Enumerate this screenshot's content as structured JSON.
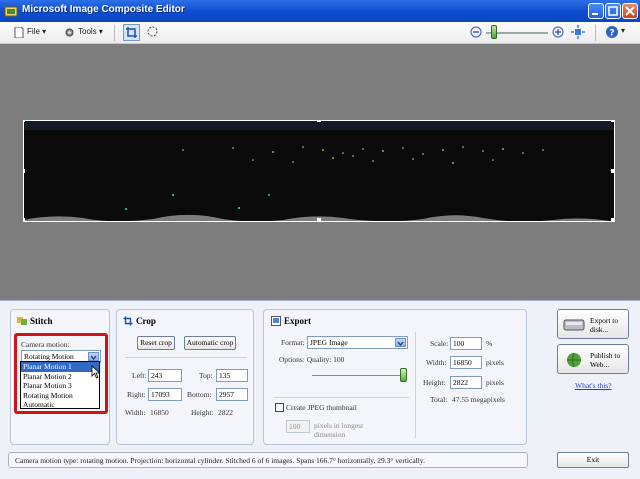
{
  "window": {
    "title": "Microsoft Image Composite Editor"
  },
  "menu": {
    "file": "File",
    "tools": "Tools"
  },
  "stitch": {
    "title": "Stitch",
    "camera_motion_label": "Camera motion:",
    "camera_motion_value": "Rotating Motion",
    "options": [
      "Planar Motion 1",
      "Planar Motion 2",
      "Planar Motion 3",
      "Rotating Motion",
      "Automatic"
    ]
  },
  "crop": {
    "title": "Crop",
    "reset_label": "Reset crop",
    "auto_label": "Automatic crop",
    "left_label": "Left:",
    "left_value": "243",
    "top_label": "Top:",
    "top_value": "135",
    "right_label": "Right:",
    "right_value": "17093",
    "bottom_label": "Bottom:",
    "bottom_value": "2957",
    "width_label": "Width:",
    "width_value": "16850",
    "height_label": "Height:",
    "height_value": "2822"
  },
  "export": {
    "title": "Export",
    "format_label": "Format:",
    "format_value": "JPEG Image",
    "options_label": "Options: Quality: 100",
    "thumbnail_label": "Create JPEG thumbnail",
    "thumb_value": "100",
    "thumb_unit": "pixels in longest dimension",
    "scale_label": "Scale:",
    "scale_value": "100",
    "scale_unit": "%",
    "width_label": "Width:",
    "width_value": "16850",
    "width_unit": "pixels",
    "height_label": "Height:",
    "height_value": "2822",
    "height_unit": "pixels",
    "total_label": "Total:",
    "total_value": "47.55 megapixels"
  },
  "actions": {
    "export_disk": "Export to disk...",
    "publish_web": "Publish to Web...",
    "whats_this": "What's this?",
    "exit": "Exit"
  },
  "status": "Camera motion type: rotating motion. Projection: horizontal cylinder. Stitched 6 of 6 images. Spans 166.7° horizontally, 29.3° vertically.",
  "colors": {
    "titlebar": "#0e4fd0",
    "canvas": "#7d7d7d",
    "highlight": "#d01414",
    "selection": "#316ac5"
  }
}
